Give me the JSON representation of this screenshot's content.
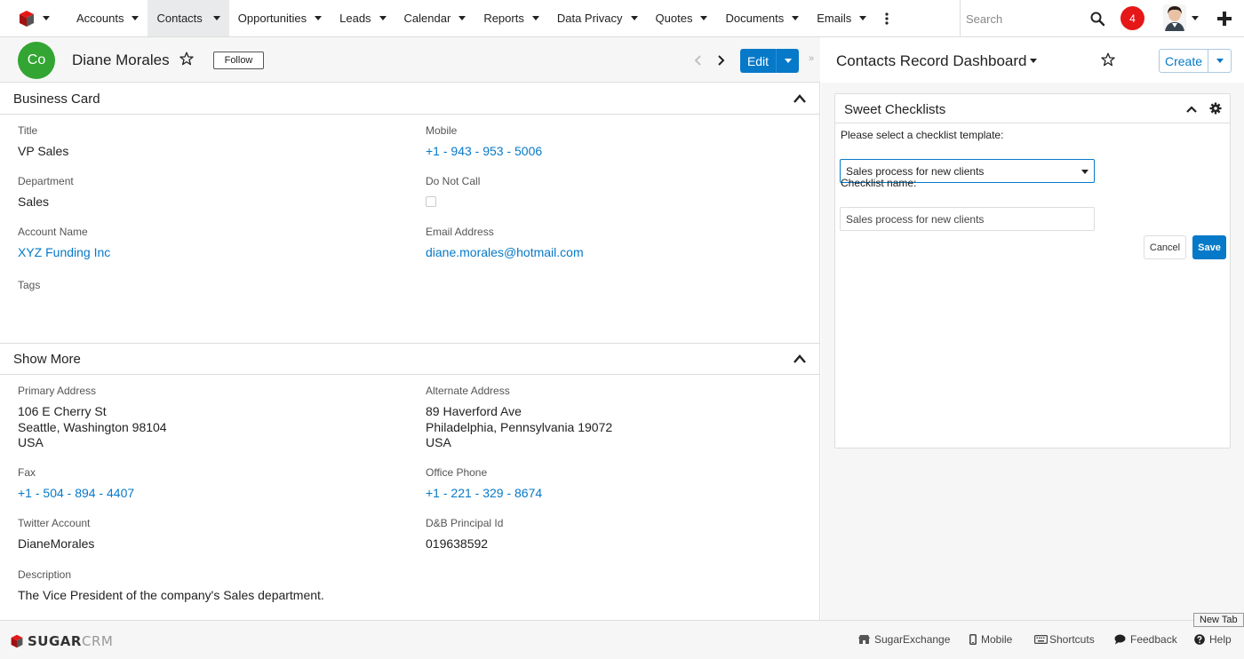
{
  "nav": {
    "items": [
      {
        "label": "Accounts",
        "active": false
      },
      {
        "label": "Contacts",
        "active": true
      },
      {
        "label": "Opportunities",
        "active": false
      },
      {
        "label": "Leads",
        "active": false
      },
      {
        "label": "Calendar",
        "active": false
      },
      {
        "label": "Reports",
        "active": false
      },
      {
        "label": "Data Privacy",
        "active": false
      },
      {
        "label": "Quotes",
        "active": false
      },
      {
        "label": "Documents",
        "active": false
      },
      {
        "label": "Emails",
        "active": false
      }
    ],
    "search_placeholder": "Search",
    "notification_count": "4"
  },
  "record": {
    "avatar_initials": "Co",
    "name": "Diane Morales",
    "follow_label": "Follow",
    "edit_label": "Edit",
    "collapse_glyph": "»"
  },
  "business_card": {
    "title": "Business Card",
    "fields": {
      "title_label": "Title",
      "title_value": "VP Sales",
      "mobile_label": "Mobile",
      "mobile_value": "+1 - 943 - 953 - 5006",
      "department_label": "Department",
      "department_value": "Sales",
      "do_not_call_label": "Do Not Call",
      "account_label": "Account Name",
      "account_value": "XYZ Funding Inc",
      "email_label": "Email Address",
      "email_value": "diane.morales@hotmail.com",
      "tags_label": "Tags"
    }
  },
  "show_more": {
    "title": "Show More",
    "fields": {
      "primary_address_label": "Primary Address",
      "primary_address_lines": [
        "106 E Cherry St",
        "Seattle, Washington 98104",
        "USA"
      ],
      "alternate_address_label": "Alternate Address",
      "alternate_address_lines": [
        "89 Haverford Ave",
        "Philadelphia, Pennsylvania 19072",
        "USA"
      ],
      "fax_label": "Fax",
      "fax_value": "+1 - 504 - 894 - 4407",
      "office_phone_label": "Office Phone",
      "office_phone_value": "+1 - 221 - 329 - 8674",
      "twitter_label": "Twitter Account",
      "twitter_value": "DianeMorales",
      "dnb_label": "D&B Principal Id",
      "dnb_value": "019638592",
      "description_label": "Description",
      "description_value": "The Vice President of the company's Sales department."
    }
  },
  "dashboard": {
    "title": "Contacts Record Dashboard",
    "create_label": "Create",
    "dashlet": {
      "title": "Sweet Checklists",
      "template_label": "Please select a checklist template:",
      "template_value": "Sales process for new clients",
      "name_label": "Checklist name:",
      "name_value": "Sales process for new clients",
      "cancel_label": "Cancel",
      "save_label": "Save"
    }
  },
  "footer": {
    "logo_bold": "SUGAR",
    "logo_light": "CRM",
    "links": {
      "exchange": "SugarExchange",
      "mobile": "Mobile",
      "shortcuts": "Shortcuts",
      "feedback": "Feedback",
      "help": "Help"
    },
    "tooltip": "New Tab"
  },
  "colors": {
    "accent": "#0679c8",
    "avatar_green": "#33a532",
    "badge_red": "#e61718",
    "active_tab_bg": "#e9eaec"
  }
}
